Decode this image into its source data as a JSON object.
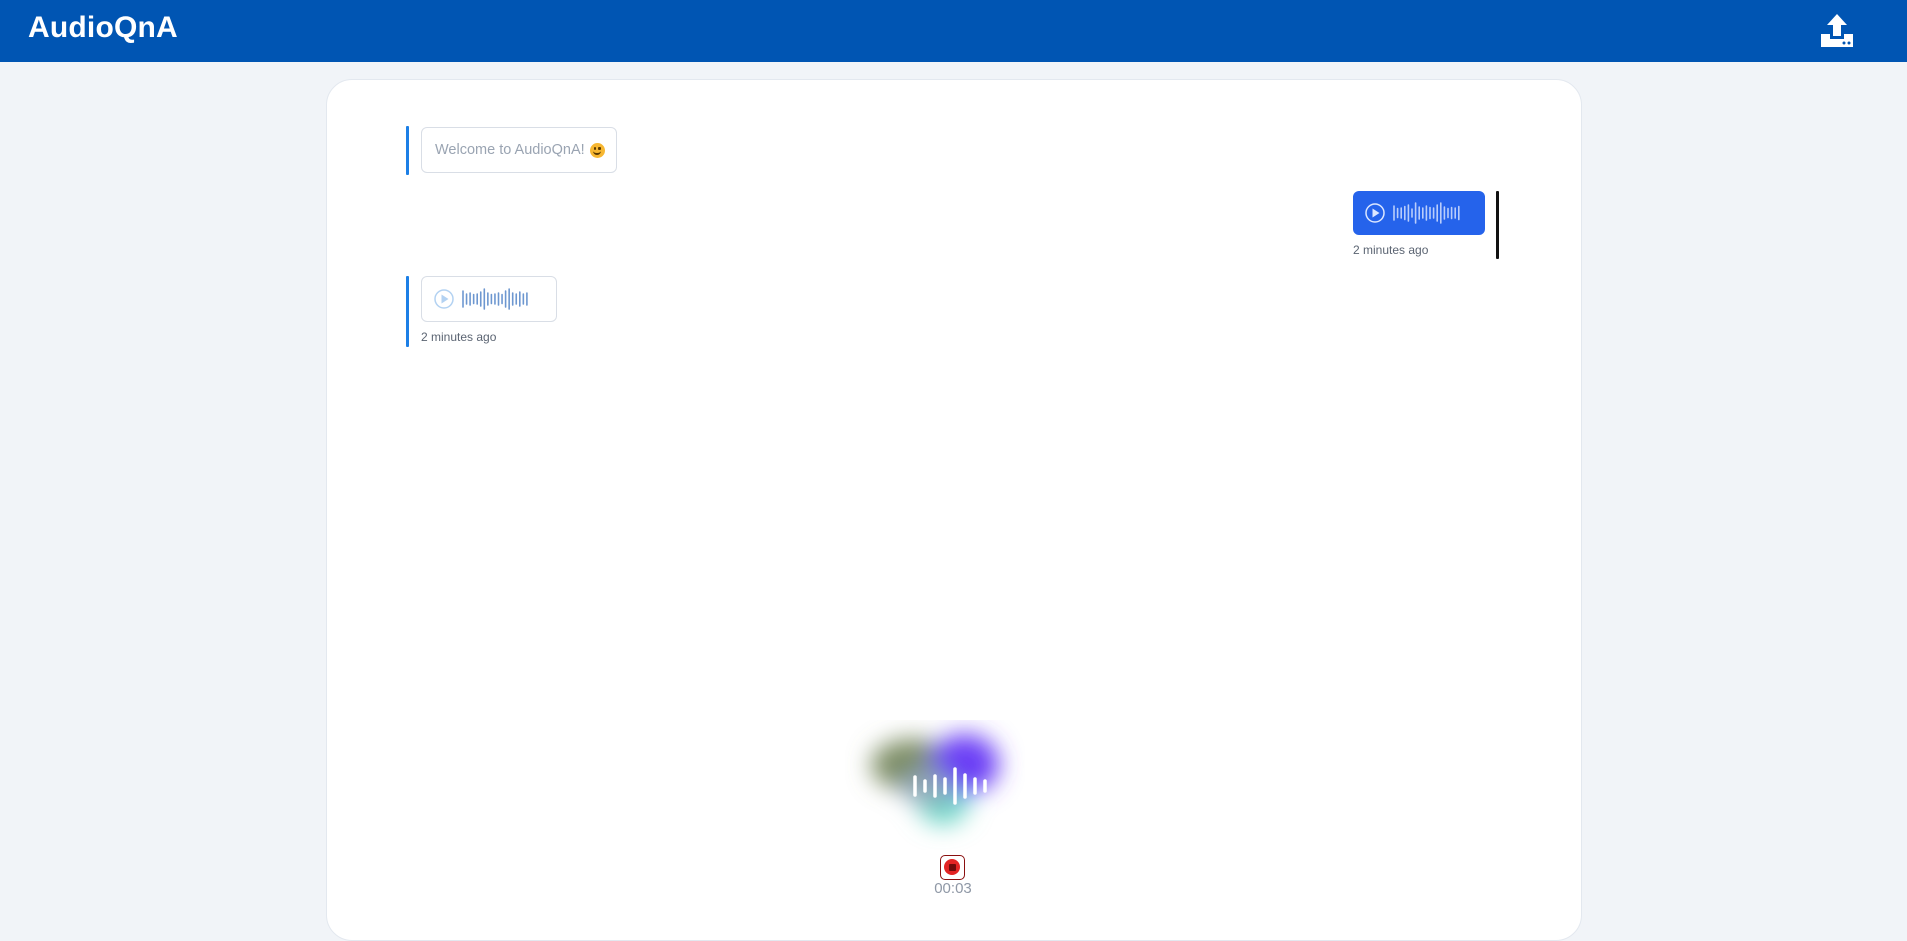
{
  "header": {
    "title": "AudioQnA",
    "upload_icon": "upload-tray-icon",
    "background": "#0055b3"
  },
  "messages": [
    {
      "role": "bot",
      "type": "text",
      "text": "Welcome to AudioQnA!",
      "emoji_icon": "smiling-face-icon"
    },
    {
      "role": "user",
      "type": "audio",
      "timestamp": "2 minutes ago",
      "color": "#2563eb"
    },
    {
      "role": "bot",
      "type": "audio",
      "timestamp": "2 minutes ago"
    }
  ],
  "recorder": {
    "timer": "00:03",
    "stop_icon": "stop-record-icon",
    "stop_color": "#e32424"
  },
  "colors": {
    "accent": "#1c7fe6",
    "panel": "#ffffff",
    "page_bg": "#f1f4f8"
  }
}
